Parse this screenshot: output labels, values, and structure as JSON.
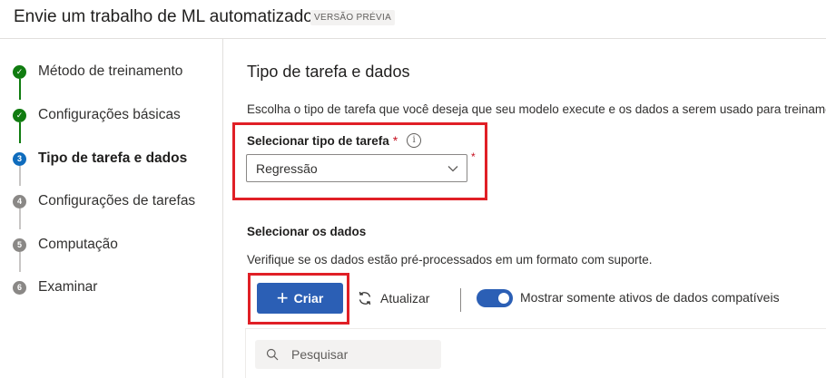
{
  "header": {
    "title": "Envie um trabalho de ML automatizado",
    "badge": "VERSÃO PRÉVIA"
  },
  "steps": [
    {
      "label": "Método de treinamento",
      "status": "done",
      "marker": "✓"
    },
    {
      "label": "Configurações básicas",
      "status": "done",
      "marker": "✓"
    },
    {
      "label": "Tipo de tarefa e dados",
      "status": "current",
      "marker": "3"
    },
    {
      "label": "Configurações de tarefas",
      "status": "pending",
      "marker": "4"
    },
    {
      "label": "Computação",
      "status": "pending",
      "marker": "5"
    },
    {
      "label": "Examinar",
      "status": "pending",
      "marker": "6"
    }
  ],
  "main": {
    "title": "Tipo de tarefa e dados",
    "description": "Escolha o tipo de tarefa que você deseja que seu modelo execute e os dados a serem usado para treinamento.",
    "task_type": {
      "label": "Selecionar tipo de tarefa",
      "required_mark": "*",
      "info_glyph": "i",
      "value": "Regressão"
    },
    "data": {
      "title": "Selecionar os dados",
      "description": "Verifique se os dados estão pré-processados em um formato com suporte.",
      "create_label": "Criar",
      "refresh_label": "Atualizar",
      "toggle_label": "Mostrar somente ativos de dados compatíveis",
      "toggle_on": true,
      "search_placeholder": "Pesquisar"
    }
  },
  "colors": {
    "done": "#107c10",
    "current": "#0f6cbd",
    "primary": "#2b5fb5",
    "highlight": "#e01f26",
    "required": "#c50f1f"
  }
}
